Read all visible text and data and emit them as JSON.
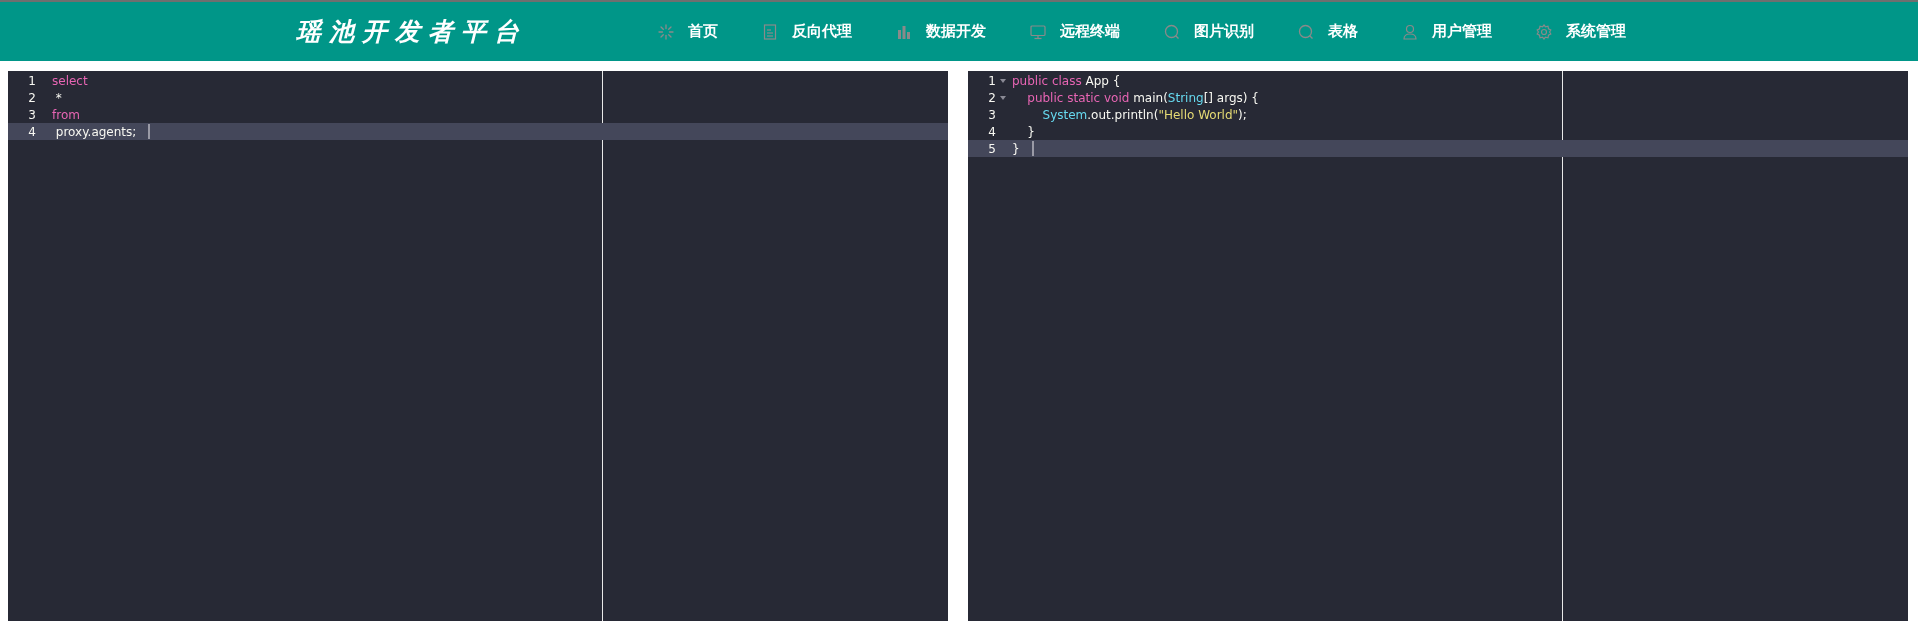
{
  "header": {
    "title": "瑶池开发者平台",
    "nav": [
      {
        "label": "首页",
        "kind": "spinner"
      },
      {
        "label": "反向代理",
        "kind": "document"
      },
      {
        "label": "数据开发",
        "kind": "bars"
      },
      {
        "label": "远程终端",
        "kind": "monitor"
      },
      {
        "label": "图片识别",
        "kind": "search"
      },
      {
        "label": "表格",
        "kind": "search"
      },
      {
        "label": "用户管理",
        "kind": "user"
      },
      {
        "label": "系统管理",
        "kind": "gear"
      }
    ]
  },
  "editors": [
    {
      "lines": [
        {
          "number": "1",
          "active": false,
          "foldable": false,
          "tokens": [
            {
              "text": "select",
              "kind": "keyword"
            }
          ]
        },
        {
          "number": "2",
          "active": false,
          "foldable": false,
          "tokens": [
            {
              "text": " *",
              "kind": "plain"
            }
          ]
        },
        {
          "number": "3",
          "active": false,
          "foldable": false,
          "tokens": [
            {
              "text": "from",
              "kind": "keyword"
            }
          ]
        },
        {
          "number": "4",
          "active": true,
          "foldable": false,
          "tokens": [
            {
              "text": " proxy.agents;",
              "kind": "plain"
            }
          ]
        }
      ]
    },
    {
      "lines": [
        {
          "number": "1",
          "active": false,
          "foldable": true,
          "tokens": [
            {
              "text": "public class",
              "kind": "keyword"
            },
            {
              "text": " App {",
              "kind": "plain"
            }
          ]
        },
        {
          "number": "2",
          "active": false,
          "foldable": true,
          "tokens": [
            {
              "text": "    public static void",
              "kind": "keyword"
            },
            {
              "text": " main(",
              "kind": "plain"
            },
            {
              "text": "String",
              "kind": "type"
            },
            {
              "text": "[] args) {",
              "kind": "plain"
            }
          ]
        },
        {
          "number": "3",
          "active": false,
          "foldable": false,
          "tokens": [
            {
              "text": "        System",
              "kind": "type"
            },
            {
              "text": ".out.println(",
              "kind": "plain"
            },
            {
              "text": "\"Hello World\"",
              "kind": "string"
            },
            {
              "text": ");",
              "kind": "plain"
            }
          ]
        },
        {
          "number": "4",
          "active": false,
          "foldable": false,
          "tokens": [
            {
              "text": "    }",
              "kind": "plain"
            }
          ]
        },
        {
          "number": "5",
          "active": true,
          "foldable": false,
          "tokens": [
            {
              "text": "}",
              "kind": "plain"
            }
          ]
        }
      ]
    }
  ]
}
